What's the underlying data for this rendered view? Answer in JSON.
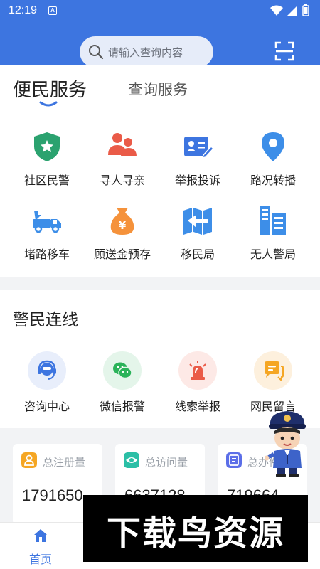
{
  "status_bar": {
    "time": "12:19",
    "app_badge": "A"
  },
  "search": {
    "placeholder": "请输入查询内容"
  },
  "tabs": [
    {
      "label": "便民服务",
      "active": true
    },
    {
      "label": "查询服务",
      "active": false
    }
  ],
  "services": [
    {
      "label": "社区民警",
      "icon": "police-shield-icon"
    },
    {
      "label": "寻人寻亲",
      "icon": "people-icon"
    },
    {
      "label": "举报投诉",
      "icon": "report-card-icon"
    },
    {
      "label": "路况转播",
      "icon": "location-pin-icon"
    },
    {
      "label": "堵路移车",
      "icon": "tow-truck-icon"
    },
    {
      "label": "顾送金预存",
      "icon": "money-bag-icon"
    },
    {
      "label": "移民局",
      "icon": "map-book-icon"
    },
    {
      "label": "无人警局",
      "icon": "building-icon"
    }
  ],
  "police_line": {
    "title": "警民连线",
    "items": [
      {
        "label": "咨询中心",
        "icon": "headset-icon"
      },
      {
        "label": "微信报警",
        "icon": "wechat-icon"
      },
      {
        "label": "线索举报",
        "icon": "alarm-light-icon"
      },
      {
        "label": "网民留言",
        "icon": "message-icon"
      }
    ]
  },
  "stats": [
    {
      "label": "总注册量",
      "value": "1791650",
      "icon": "user-icon"
    },
    {
      "label": "总访问量",
      "value": "6637128",
      "icon": "eye-icon"
    },
    {
      "label": "总办件",
      "value": "719664",
      "icon": "document-icon"
    }
  ],
  "bottom_nav": {
    "home_label": "首页"
  },
  "watermark": {
    "text": "下载鸟资源"
  },
  "colors": {
    "primary": "#3d75e0",
    "green": "#2ba26f",
    "red": "#ea5b48",
    "orange": "#f5923b"
  }
}
